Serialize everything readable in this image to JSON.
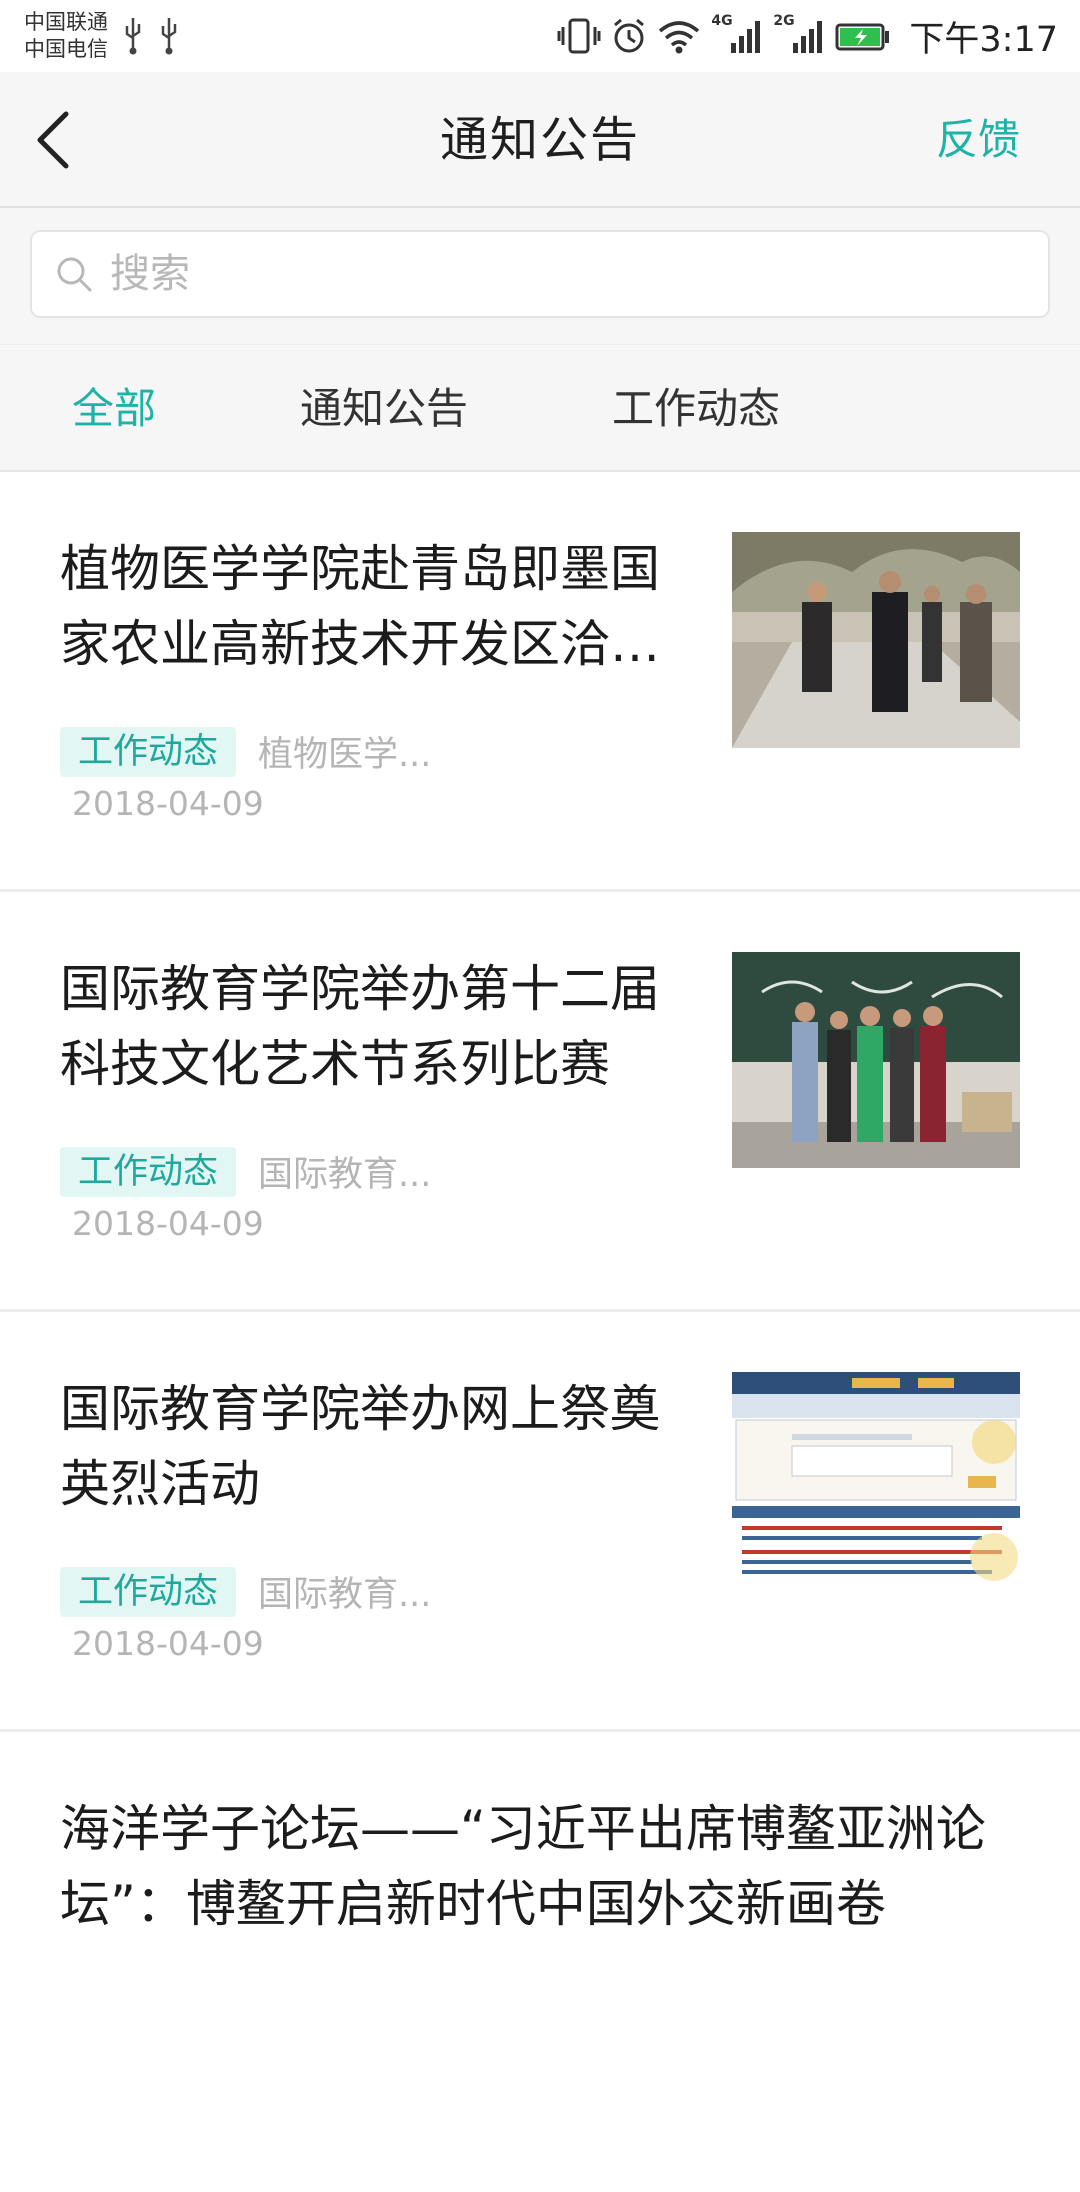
{
  "status_bar": {
    "carrier_1": "中国联通",
    "carrier_2": "中国电信",
    "time": "下午3:17",
    "icons": [
      "usb-icon",
      "usb-icon",
      "vibrate-icon",
      "alarm-icon",
      "wifi-icon",
      "signal-4g-icon",
      "signal-2g-icon",
      "battery-charging-icon"
    ],
    "network_1": "4G",
    "network_2": "2G"
  },
  "header": {
    "title": "通知公告",
    "feedback_label": "反馈",
    "back_icon": "chevron-left-icon"
  },
  "search": {
    "placeholder": "搜索",
    "icon": "search-icon"
  },
  "tabs": [
    {
      "label": "全部",
      "active": true
    },
    {
      "label": "通知公告",
      "active": false
    },
    {
      "label": "工作动态",
      "active": false
    }
  ],
  "colors": {
    "accent": "#1fb3a7",
    "tag_bg": "#e2f7f4",
    "muted_text": "#b5b5b5",
    "header_bg": "#f6f6f6"
  },
  "news": [
    {
      "title": "植物医学学院赴青岛即墨国家农业高新技术开发区洽谈…",
      "tag": "工作动态",
      "source": "植物医学...",
      "date": "2018-04-09",
      "thumbnail": "photo-officials-walking-icon"
    },
    {
      "title": "国际教育学院举办第十二届科技文化艺术节系列比赛",
      "tag": "工作动态",
      "source": "国际教育...",
      "date": "2018-04-09",
      "thumbnail": "photo-students-classroom-icon"
    },
    {
      "title": "国际教育学院举办网上祭奠英烈活动",
      "tag": "工作动态",
      "source": "国际教育...",
      "date": "2018-04-09",
      "thumbnail": "webpage-screenshot-icon"
    },
    {
      "title": "海洋学子论坛——“习近平出席博鳌亚洲论坛”：博鳌开启新时代中国外交新画卷"
    }
  ]
}
